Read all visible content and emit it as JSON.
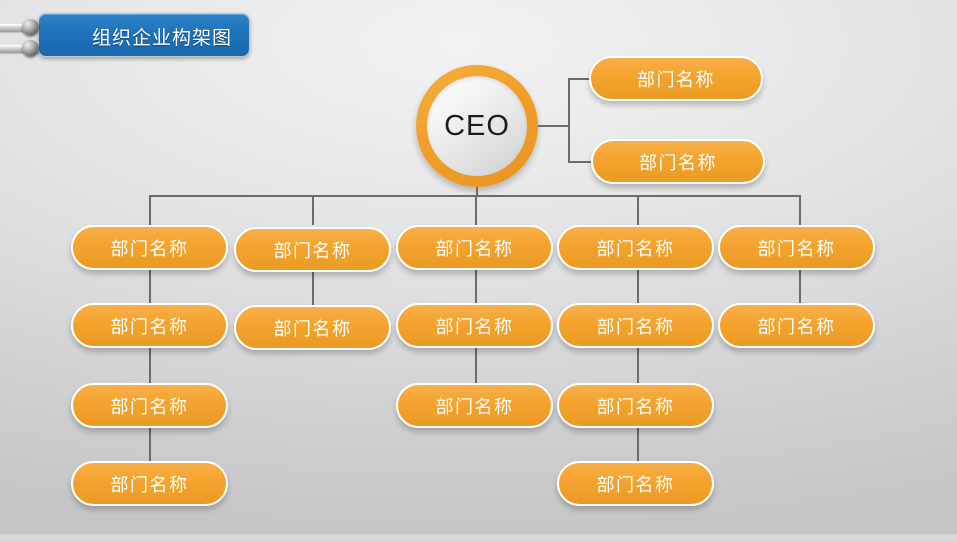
{
  "slide": {
    "title": "组织企业构架图",
    "background_color": "#dcdcde"
  },
  "chart_data": {
    "type": "diagram",
    "diagram_kind": "organizational-chart",
    "title": "组织企业构架图",
    "root": {
      "label": "CEO",
      "shape": "circle",
      "ring_color": "#f0a02a",
      "fill_color": "#eeeef0",
      "text_color": "#1b1b1f"
    },
    "node_label": "部门名称",
    "node_fill_color": "#f5a42f",
    "node_border_color": "#ffffff",
    "node_text_color": "#ffffff",
    "connector_color": "#6b6b6d",
    "side_branch": {
      "position": "right-of-root",
      "nodes": [
        {
          "label": "部门名称"
        },
        {
          "label": "部门名称"
        }
      ]
    },
    "columns": [
      {
        "index": 1,
        "count": 4,
        "nodes": [
          {
            "label": "部门名称"
          },
          {
            "label": "部门名称"
          },
          {
            "label": "部门名称"
          },
          {
            "label": "部门名称"
          }
        ]
      },
      {
        "index": 2,
        "count": 2,
        "nodes": [
          {
            "label": "部门名称"
          },
          {
            "label": "部门名称"
          }
        ]
      },
      {
        "index": 3,
        "count": 3,
        "nodes": [
          {
            "label": "部门名称"
          },
          {
            "label": "部门名称"
          },
          {
            "label": "部门名称"
          }
        ]
      },
      {
        "index": 4,
        "count": 4,
        "nodes": [
          {
            "label": "部门名称"
          },
          {
            "label": "部门名称"
          },
          {
            "label": "部门名称"
          },
          {
            "label": "部门名称"
          }
        ]
      },
      {
        "index": 5,
        "count": 2,
        "nodes": [
          {
            "label": "部门名称"
          },
          {
            "label": "部门名称"
          }
        ]
      }
    ],
    "total_department_nodes": 17
  }
}
